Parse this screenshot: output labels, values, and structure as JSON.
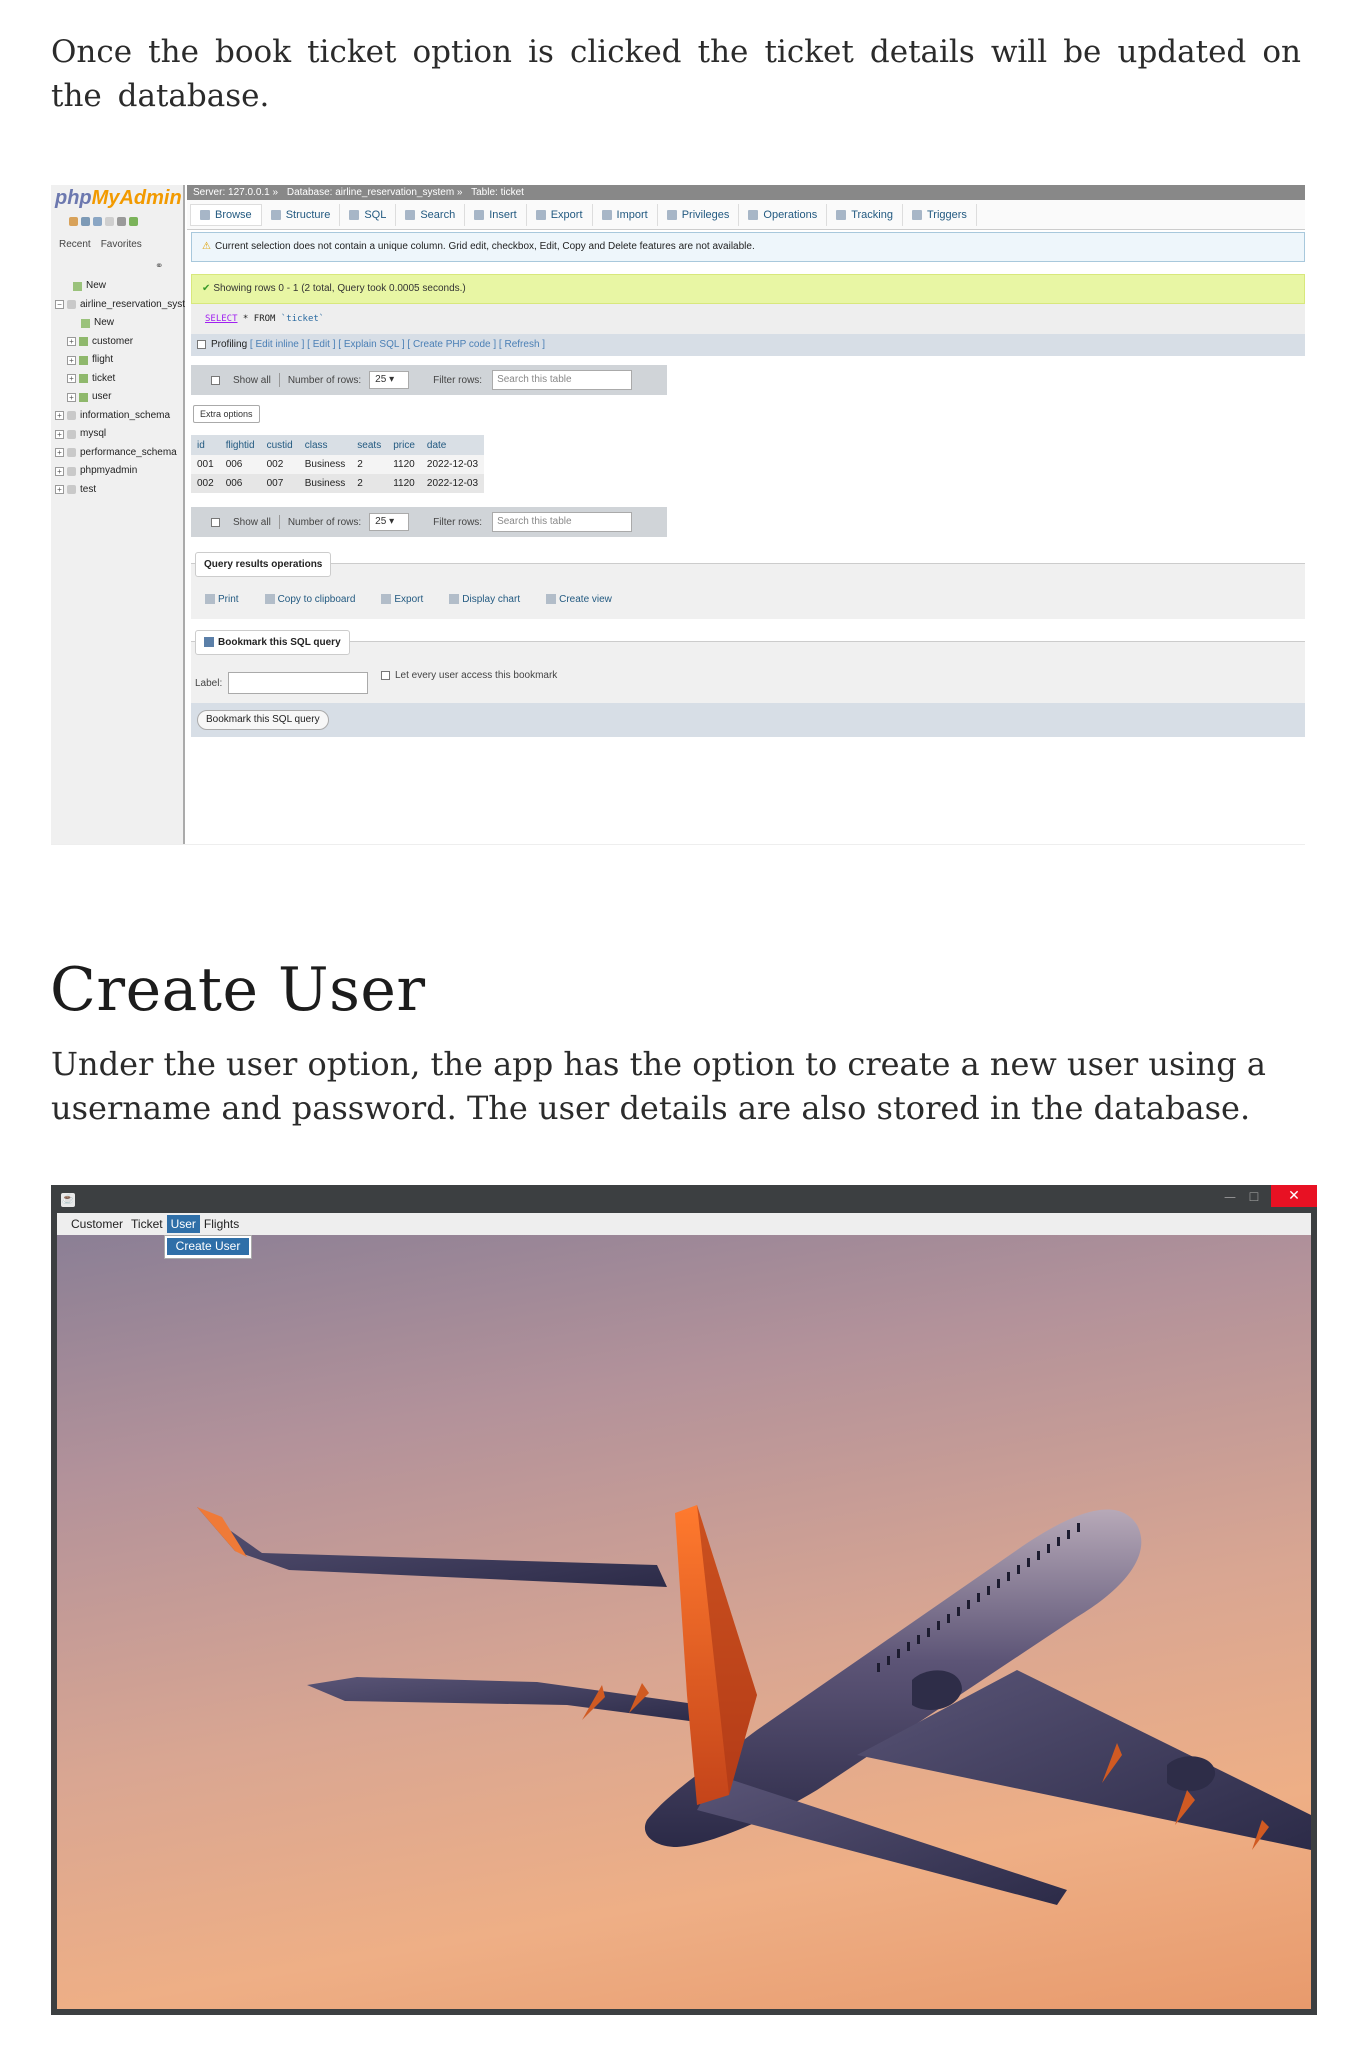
{
  "text": {
    "intro_paragraph": "Once the book ticket option is clicked the ticket details will be updated on the database.",
    "create_user_heading": "Create User",
    "create_user_paragraph": "Under the user option, the app has the option to create a new user using a username and password. The user details are also stored in the database."
  },
  "pma": {
    "logo_a": "php",
    "logo_b": "MyAdmin",
    "side_tabs": [
      "Recent",
      "Favorites"
    ],
    "tree": [
      {
        "label": "New",
        "type": "new"
      },
      {
        "label": "airline_reservation_system",
        "type": "db"
      },
      {
        "label": "New",
        "type": "new"
      },
      {
        "label": "customer",
        "type": "table"
      },
      {
        "label": "flight",
        "type": "table"
      },
      {
        "label": "ticket",
        "type": "table"
      },
      {
        "label": "user",
        "type": "table"
      },
      {
        "label": "information_schema",
        "type": "db"
      },
      {
        "label": "mysql",
        "type": "db"
      },
      {
        "label": "performance_schema",
        "type": "db"
      },
      {
        "label": "phpmyadmin",
        "type": "db"
      },
      {
        "label": "test",
        "type": "db"
      }
    ],
    "breadcrumb": {
      "server": "Server: 127.0.0.1 »",
      "database": "Database: airline_reservation_system »",
      "table": "Table: ticket"
    },
    "tabs": [
      "Browse",
      "Structure",
      "SQL",
      "Search",
      "Insert",
      "Export",
      "Import",
      "Privileges",
      "Operations",
      "Tracking",
      "Triggers"
    ],
    "notice": "Current selection does not contain a unique column. Grid edit, checkbox, Edit, Copy and Delete features are not available.",
    "success": "Showing rows 0 - 1 (2 total, Query took 0.0005 seconds.)",
    "sql": {
      "kw": "SELECT",
      "rest": " * FROM ",
      "table": "`ticket`"
    },
    "profiling": {
      "label": "Profiling",
      "links": "[ Edit inline ] [ Edit ] [ Explain SQL ] [ Create PHP code ] [ Refresh ]"
    },
    "nav": {
      "show_all": "Show all",
      "rows_label": "Number of rows:",
      "rows_value": "25",
      "filter_label": "Filter rows:",
      "filter_placeholder": "Search this table"
    },
    "extra_options": "Extra options",
    "table": {
      "headers": [
        "id",
        "flightid",
        "custid",
        "class",
        "seats",
        "price",
        "date"
      ],
      "rows": [
        [
          "001",
          "006",
          "002",
          "Business",
          "2",
          "1120",
          "2022-12-03"
        ],
        [
          "002",
          "006",
          "007",
          "Business",
          "2",
          "1120",
          "2022-12-03"
        ]
      ]
    },
    "query_ops": {
      "legend": "Query results operations",
      "items": [
        "Print",
        "Copy to clipboard",
        "Export",
        "Display chart",
        "Create view"
      ]
    },
    "bookmark": {
      "legend": "Bookmark this SQL query",
      "label": "Label:",
      "checkbox": "Let every user access this bookmark",
      "button": "Bookmark this SQL query"
    }
  },
  "app": {
    "menus": [
      "Customer",
      "Ticket",
      "User",
      "Flights"
    ],
    "active_menu": "User",
    "dropdown_item": "Create User",
    "close_glyph": "✕",
    "minimize_glyph": "—",
    "maximize_glyph": "☐"
  }
}
